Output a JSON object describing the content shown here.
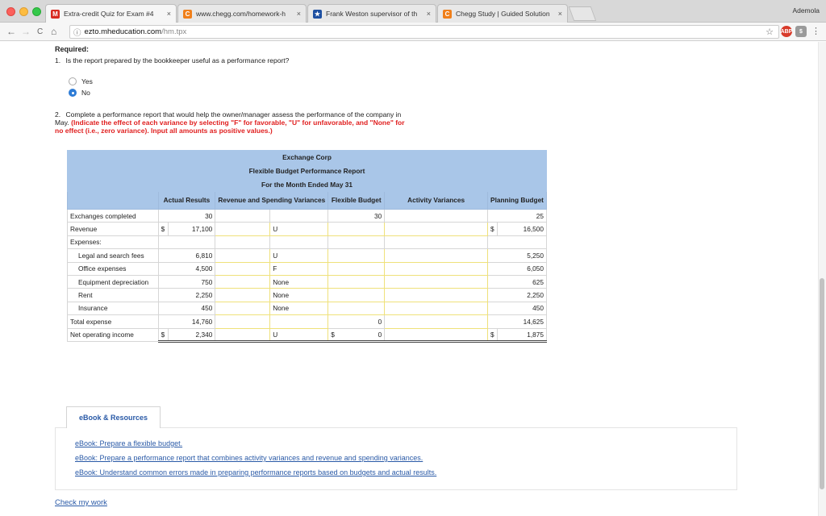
{
  "browser": {
    "tabs": [
      {
        "icon": "M",
        "title": "Extra-credit Quiz for Exam #4",
        "close": "×"
      },
      {
        "icon": "C",
        "title": "www.chegg.com/homework-h",
        "close": "×"
      },
      {
        "icon": "★",
        "title": "Frank Weston supervisor of th",
        "close": "×"
      },
      {
        "icon": "C",
        "title": "Chegg Study | Guided Solution",
        "close": "×"
      }
    ],
    "user": "Ademola",
    "url_host": "ezto.mheducation.com",
    "url_path": "/hm.tpx",
    "nav": {
      "back": "←",
      "forward": "→",
      "reload": "C",
      "home": "⌂",
      "info": "ⓘ",
      "star": "☆",
      "menu": "⋮"
    }
  },
  "page": {
    "required_label": "Required:",
    "q1_number": "1.",
    "q1_text": "Is the report prepared by the bookkeeper useful as a performance report?",
    "options": [
      {
        "label": "Yes",
        "selected": false
      },
      {
        "label": "No",
        "selected": true
      }
    ],
    "q2_number": "2.",
    "q2_text_a": "Complete a performance report that would help the owner/manager assess the performance of the company in May.",
    "q2_text_b": "(Indicate the effect of each variance by selecting \"F\" for favorable, \"U\" for unfavorable, and \"None\" for no effect (i.e., zero variance). Input all amounts as positive values.)"
  },
  "report": {
    "company": "Exchange Corp",
    "title": "Flexible Budget Performance Report",
    "period": "For the Month Ended May 31",
    "columns": {
      "actual": "Actual Results",
      "rev_spend": "Revenue and Spending Variances",
      "flexible": "Flexible Budget",
      "activity": "Activity Variances",
      "planning": "Planning Budget"
    },
    "rows": {
      "exchanges": {
        "label": "Exchanges completed",
        "actual": "30",
        "flexible": "30",
        "planning": "25"
      },
      "revenue": {
        "label": "Revenue",
        "dollar": "$",
        "actual": "17,100",
        "rs_effect": "U",
        "planning": "16,500"
      },
      "expenses": {
        "label": "Expenses:"
      },
      "legal": {
        "label": "Legal and search fees",
        "actual": "6,810",
        "rs_effect": "U",
        "planning": "5,250"
      },
      "office": {
        "label": "Office expenses",
        "actual": "4,500",
        "rs_effect": "F",
        "planning": "6,050"
      },
      "equipment": {
        "label": "Equipment depreciation",
        "actual": "750",
        "rs_effect": "None",
        "planning": "625"
      },
      "rent": {
        "label": "Rent",
        "actual": "2,250",
        "rs_effect": "None",
        "planning": "2,250"
      },
      "insurance": {
        "label": "Insurance",
        "actual": "450",
        "rs_effect": "None",
        "planning": "450"
      },
      "total": {
        "label": "Total expense",
        "actual": "14,760",
        "flexible": "0",
        "planning": "14,625"
      },
      "noi": {
        "label": "Net operating income",
        "actual": "2,340",
        "rs_effect": "U",
        "flexible": "0",
        "planning": "1,875"
      }
    }
  },
  "resources": {
    "tab_label": "eBook & Resources",
    "links": [
      "eBook: Prepare a flexible budget.",
      "eBook: Prepare a performance report that combines activity variances and revenue and spending variances.",
      "eBook: Understand common errors made in preparing performance reports based on budgets and actual results."
    ],
    "check_work": "Check my work"
  },
  "colors": {
    "header_blue": "#a9c6e8",
    "link_blue": "#2a5aa7",
    "instruction_red": "#e01e1e",
    "radio_blue": "#2e7cd6"
  }
}
